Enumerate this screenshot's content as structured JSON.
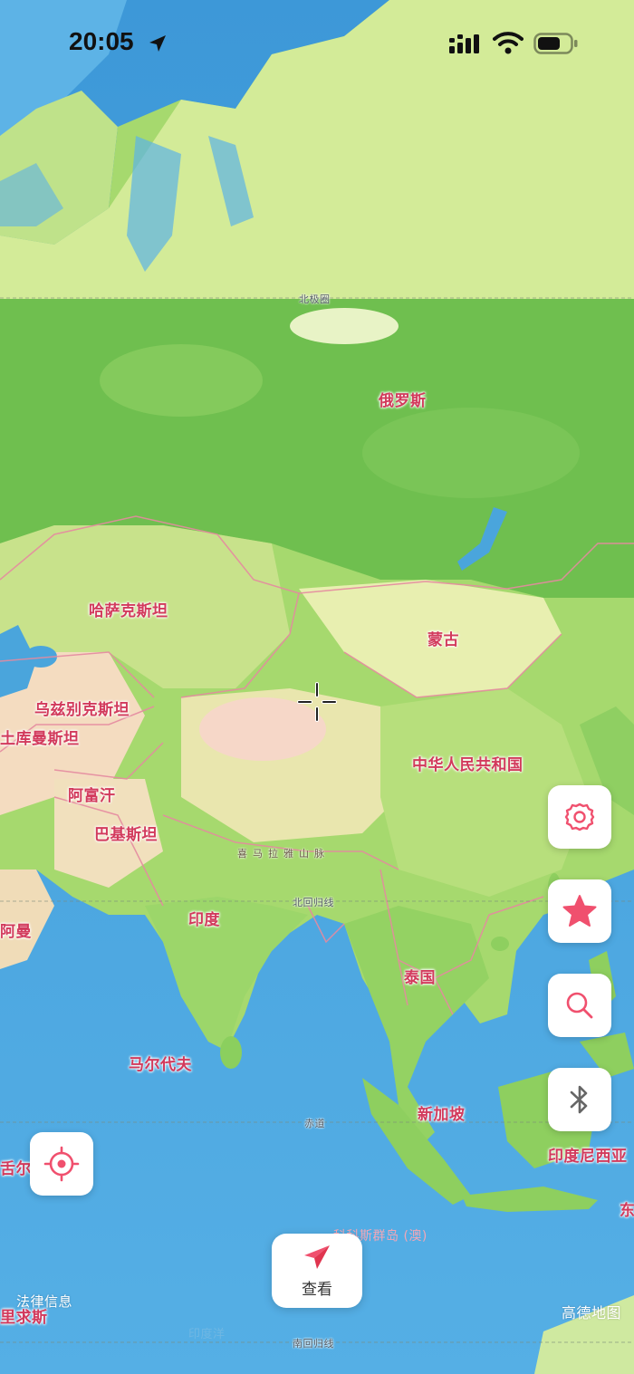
{
  "status_bar": {
    "time": "20:05",
    "location_icon": "location-arrow-icon",
    "signal_icon": "cellular-signal-icon",
    "wifi_icon": "wifi-icon",
    "battery_icon": "battery-icon"
  },
  "map": {
    "country_labels": {
      "russia": "俄罗斯",
      "kazakhstan": "哈萨克斯坦",
      "mongolia": "蒙古",
      "uzbekistan": "乌兹别克斯坦",
      "turkmenistan": "土库曼斯坦",
      "afghanistan": "阿富汗",
      "pakistan": "巴基斯坦",
      "china": "中华人民共和国",
      "india": "印度",
      "oman": "阿曼",
      "thailand": "泰国",
      "maldives": "马尔代夫",
      "singapore": "新加坡",
      "indonesia": "印度尼西亚",
      "seychelles_partial": "舌尔",
      "east_partial": "东",
      "mauritius_partial": "里求斯"
    },
    "line_labels": {
      "arctic_circle": "北极圈",
      "tropic_of_cancer": "北回归线",
      "equator": "赤道",
      "tropic_of_capricorn": "南回归线"
    },
    "feature_labels": {
      "himalaya": "喜马拉雅山脉",
      "cocos_islands": "科科斯群岛 (澳)",
      "indian_ocean": "印度洋",
      "legal_info": "法律信息",
      "provider": "高德地图"
    }
  },
  "buttons": {
    "settings_icon": "gear-icon",
    "favorites_icon": "star-icon",
    "search_icon": "search-icon",
    "bluetooth_icon": "bluetooth-icon",
    "locate_icon": "locate-target-icon",
    "view_icon": "paper-plane-icon",
    "view_label": "查看"
  },
  "colors": {
    "accent": "#f0506e",
    "ocean": "#4fa6de",
    "land_forest": "#7cc75a",
    "land_tundra": "#d6ec9a",
    "border": "#e58aa0",
    "label": "#d23a5c"
  }
}
